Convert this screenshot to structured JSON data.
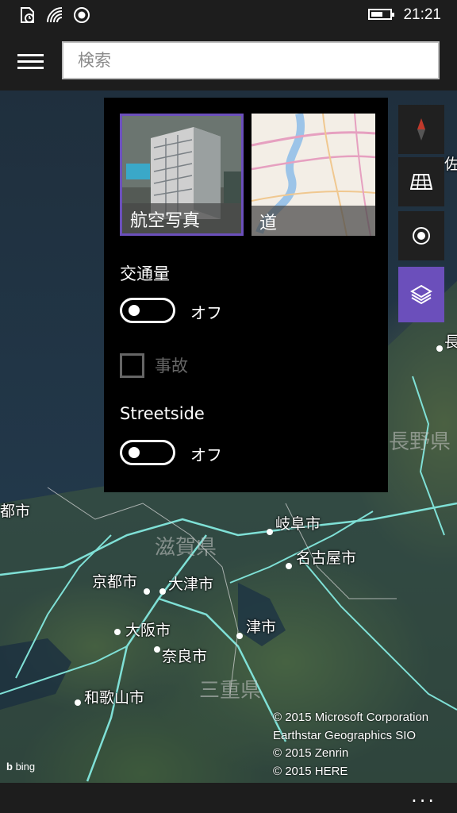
{
  "status_bar": {
    "time": "21:21",
    "battery_level": 0.62,
    "icons": [
      "clock-sync-icon",
      "wifi-icon",
      "location-icon",
      "battery-icon"
    ]
  },
  "header": {
    "search_placeholder": "検索",
    "menu_icon": "hamburger-icon"
  },
  "layer_panel": {
    "map_styles": [
      {
        "label": "航空写真",
        "selected": true
      },
      {
        "label": "道",
        "selected": false
      }
    ],
    "traffic": {
      "title": "交通量",
      "toggle_label": "オフ",
      "on": false
    },
    "incidents": {
      "label": "事故",
      "checked": false,
      "enabled": false
    },
    "streetside": {
      "title": "Streetside",
      "toggle_label": "オフ",
      "on": false
    }
  },
  "map_controls": [
    "compass-icon",
    "3d-view-icon",
    "my-location-icon",
    "layers-icon"
  ],
  "map_labels": {
    "gifu": "岐阜市",
    "nagoya": "名古屋市",
    "kyoto": "京都市",
    "otsu": "大津市",
    "osaka": "大阪市",
    "tsu": "津市",
    "nara": "奈良市",
    "wakayama": "和歌山市",
    "nagano": "長野県",
    "mie": "三重県",
    "shiga": "滋賀県",
    "city_left": "都市",
    "edge_right_top": "佐",
    "edge_right_mid": "長"
  },
  "attribution": {
    "line1": "© 2015 Microsoft Corporation",
    "line2": "Earthstar Geographics  SIO",
    "line3": "© 2015 Zenrin",
    "line4": "© 2015 HERE"
  },
  "bing_logo": "bing",
  "app_bar": {
    "more_label": "..."
  }
}
